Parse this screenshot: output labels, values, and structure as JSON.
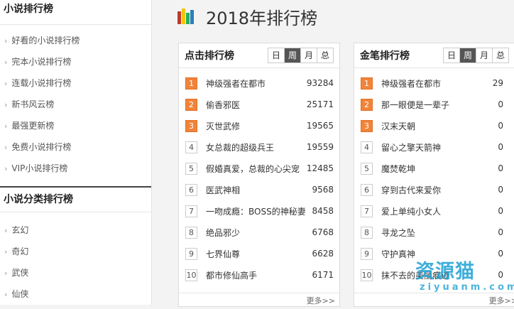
{
  "sidebar": {
    "section1_title": "小说排行榜",
    "section1_items": [
      "好看的小说排行榜",
      "完本小说排行榜",
      "连载小说排行榜",
      "新书风云榜",
      "最强更新榜",
      "免费小说排行榜",
      "VIP小说排行榜"
    ],
    "section2_title": "小说分类排行榜",
    "section2_items": [
      "玄幻",
      "奇幻",
      "武侠",
      "仙侠"
    ],
    "arrow": "›"
  },
  "header": {
    "title": "2018年排行榜",
    "icon_colors": [
      "#c0392b",
      "#f1c40f",
      "#27ae60",
      "#2980b9"
    ]
  },
  "panels": [
    {
      "title": "点击排行榜",
      "tabs": [
        "日",
        "周",
        "月",
        "总"
      ],
      "active_tab": 1,
      "items": [
        {
          "rank": "1",
          "name": "神级强者在都市",
          "value": "93284"
        },
        {
          "rank": "2",
          "name": "偷香邪医",
          "value": "25171"
        },
        {
          "rank": "3",
          "name": "灭世武修",
          "value": "19565"
        },
        {
          "rank": "4",
          "name": "女总裁的超级兵王",
          "value": "19559"
        },
        {
          "rank": "5",
          "name": "假婚真爱，总裁的心尖宠",
          "value": "12485"
        },
        {
          "rank": "6",
          "name": "医武神相",
          "value": "9568"
        },
        {
          "rank": "7",
          "name": "一吻成瘾：BOSS的神秘妻",
          "value": "8458"
        },
        {
          "rank": "8",
          "name": "绝品邪少",
          "value": "6768"
        },
        {
          "rank": "9",
          "name": "七界仙尊",
          "value": "6628"
        },
        {
          "rank": "10",
          "name": "都市修仙高手",
          "value": "6171"
        }
      ],
      "more": "更多>>"
    },
    {
      "title": "金笔排行榜",
      "tabs": [
        "日",
        "周",
        "月",
        "总"
      ],
      "active_tab": 1,
      "items": [
        {
          "rank": "1",
          "name": "神级强者在都市",
          "value": "29"
        },
        {
          "rank": "2",
          "name": "那一眼便是一辈子",
          "value": "0"
        },
        {
          "rank": "3",
          "name": "汉末天朝",
          "value": "0"
        },
        {
          "rank": "4",
          "name": "留心之擎天箭神",
          "value": "0"
        },
        {
          "rank": "5",
          "name": "魔焚乾坤",
          "value": "0"
        },
        {
          "rank": "6",
          "name": "穿到古代来爱你",
          "value": "0"
        },
        {
          "rank": "7",
          "name": "爱上单纯小女人",
          "value": "0"
        },
        {
          "rank": "8",
          "name": "寻龙之坠",
          "value": "0"
        },
        {
          "rank": "9",
          "name": "守护真神",
          "value": "0"
        },
        {
          "rank": "10",
          "name": "抹不去的美丽痕迹",
          "value": "0"
        }
      ],
      "more": "更多>>"
    }
  ],
  "watermark": {
    "main": "资源猫",
    "sub": "ziyuanm.com"
  }
}
